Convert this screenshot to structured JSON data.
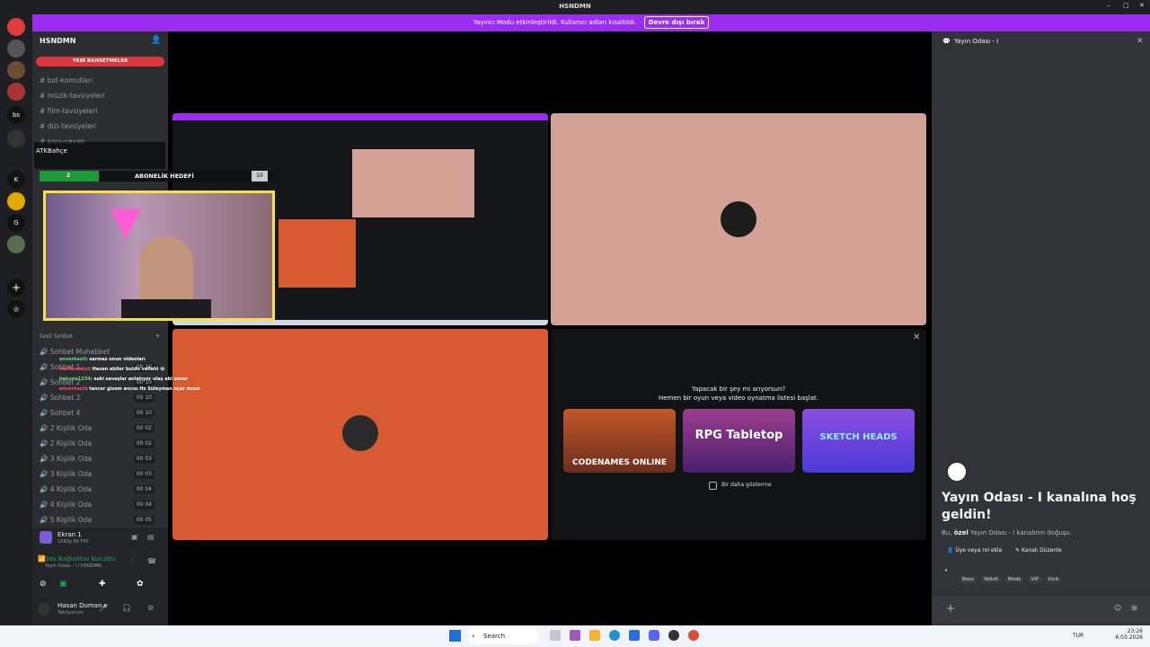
{
  "window": {
    "title": "HSNDMN"
  },
  "banner": {
    "text": "Yayıncı Modu etkinleştirildi. Kullanıcı adları kısaltıldı.",
    "button": "Devre dışı bırak"
  },
  "guilds": [
    "bs",
    "K",
    "G"
  ],
  "server": {
    "name": "HSNDMN",
    "new_mentions": "YENİ BAHSETMELER"
  },
  "text_channels": [
    {
      "label": "bot-komutları"
    },
    {
      "label": "müzik-tavsiyeleri"
    },
    {
      "label": "film-tavsiyeleri"
    },
    {
      "label": "dizi-tavsiyeleri"
    },
    {
      "label": "soru-cevap"
    }
  ],
  "voice_category": "Sesli Sohbet",
  "voice_channels": [
    {
      "label": "Sohbet Muhabbet",
      "count": ""
    },
    {
      "label": "Sohbet 1",
      "count": "00 10"
    },
    {
      "label": "Sohbet 2",
      "count": "00 10"
    },
    {
      "label": "Sohbet 3",
      "count": "00 10"
    },
    {
      "label": "Sohbet 4",
      "count": "00 10"
    },
    {
      "label": "2 Kişilik Oda",
      "count": "00 02"
    },
    {
      "label": "2 Kişilik Oda",
      "count": "00 02"
    },
    {
      "label": "3 Kişilik Oda",
      "count": "00 03"
    },
    {
      "label": "3 Kişilik Oda",
      "count": "00 03"
    },
    {
      "label": "4 Kişilik Oda",
      "count": "00 04"
    },
    {
      "label": "4 Kişilik Oda",
      "count": "00 04"
    },
    {
      "label": "5 Kişilik Oda",
      "count": "00 05"
    }
  ],
  "overlay": {
    "user": "ATKBahçe",
    "goal_label": "ABONELİK HEDEFİ",
    "goal_current": "2",
    "goal_target": "10",
    "chat": [
      {
        "user": "enverkavil",
        "msg": ": sarmaz onun videoları"
      },
      {
        "user": "meritceaksi",
        "msg": ": Hasan abiler buldu vallahi 😂"
      },
      {
        "user": "hakuna1234",
        "msg": ": eski savaşlar anlatıyor ulaş abi sever"
      },
      {
        "user": "enverkavil",
        "msg": ": tancer gizem avcısı Hz Süleyman açar mısın"
      }
    ]
  },
  "stream_screen": {
    "label": "Ekran 1",
    "sub": "1080p 60 FPS"
  },
  "voice_status": {
    "title": "Ses Bağlantısı Kuruldu",
    "sub": "Yayın Odası - I / HSNDMN"
  },
  "user": {
    "name": "Hasan Duman",
    "status": "Takılıyorum"
  },
  "activity": {
    "line1": "Yapacak bir şey mi arıyorsun?",
    "line2": "Hemen bir oyun veya video oynatma listesi başlat.",
    "games": [
      {
        "name": "CODENAMES ONLINE"
      },
      {
        "name": "RPG Tabletop"
      },
      {
        "name": "SKETCH HEADS"
      }
    ],
    "dont_show": "Bir daha gösterme"
  },
  "right_panel": {
    "header": "Yayın Odası - I",
    "welcome": "Yayın Odası - I kanalına hoş geldin!",
    "desc_pre": "Bu,",
    "desc_bold": "özel",
    "desc_post": "Yayın Odası - I kanalının doğuşu.",
    "action1": "Üye veya rol ekle",
    "action2": "Kanalı Düzenle",
    "roles": [
      "Boss",
      "Yetkili",
      "Modz",
      "VIP",
      "Kick"
    ]
  },
  "taskbar": {
    "search": "Search",
    "lang": "TUR",
    "time": "23:26",
    "date": "6.03.2026"
  },
  "colors": {
    "accent": "#9b2cf0",
    "tile_pink": "#d4a196",
    "tile_orange": "#d75a33"
  }
}
